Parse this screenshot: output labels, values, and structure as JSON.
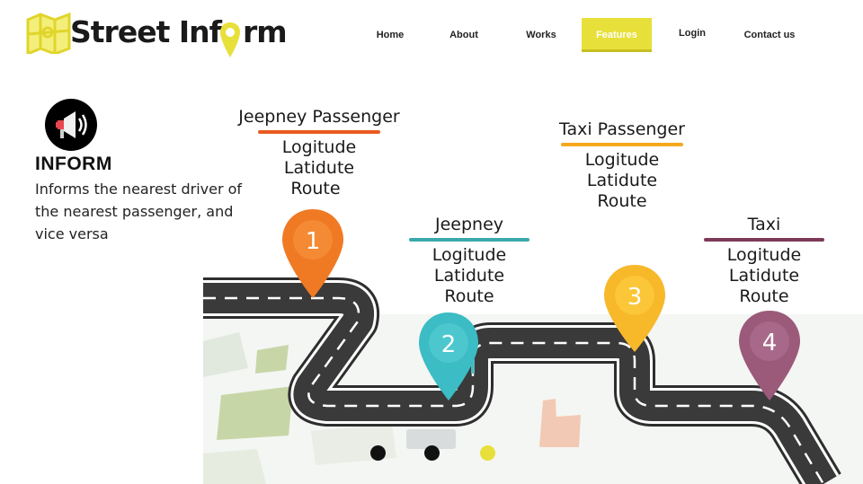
{
  "brand": {
    "name": "Street Inform",
    "name_prefix": "Street Inf",
    "name_suffix": "rm",
    "accent_color": "#e8e03a",
    "map_icon": "map-icon",
    "pin_icon": "location-pin-icon"
  },
  "nav": {
    "items": [
      {
        "label": "Home"
      },
      {
        "label": "About"
      },
      {
        "label": "Works"
      },
      {
        "label": "Features",
        "active": true
      },
      {
        "label": "Login"
      },
      {
        "label": "Contact us"
      }
    ]
  },
  "inform": {
    "icon": "megaphone-icon",
    "title": "INFORM",
    "description": "Informs the nearest driver of the nearest passenger, and vice versa"
  },
  "roadmap": {
    "steps": [
      {
        "number": "1",
        "title": "Jeepney Passenger",
        "lines": [
          "Logitude",
          "Latidute",
          "Route"
        ],
        "color": "#f07a24",
        "bar_color": "#e95a1e"
      },
      {
        "number": "2",
        "title": "Jeepney",
        "lines": [
          "Logitude",
          "Latidute",
          "Route"
        ],
        "color": "#3cbcc4",
        "bar_color": "#3aa9ad"
      },
      {
        "number": "3",
        "title": "Taxi Passenger",
        "lines": [
          "Logitude",
          "Latidute",
          "Route"
        ],
        "color": "#f7b82a",
        "bar_color": "#f5a81d"
      },
      {
        "number": "4",
        "title": "Taxi",
        "lines": [
          "Logitude",
          "Latidute",
          "Route"
        ],
        "color": "#9b5a7a",
        "bar_color": "#7c3a58"
      }
    ]
  },
  "carousel": {
    "dots": [
      {
        "color": "#111111"
      },
      {
        "color": "#111111"
      },
      {
        "color": "#e8e03a",
        "active": true
      }
    ]
  }
}
